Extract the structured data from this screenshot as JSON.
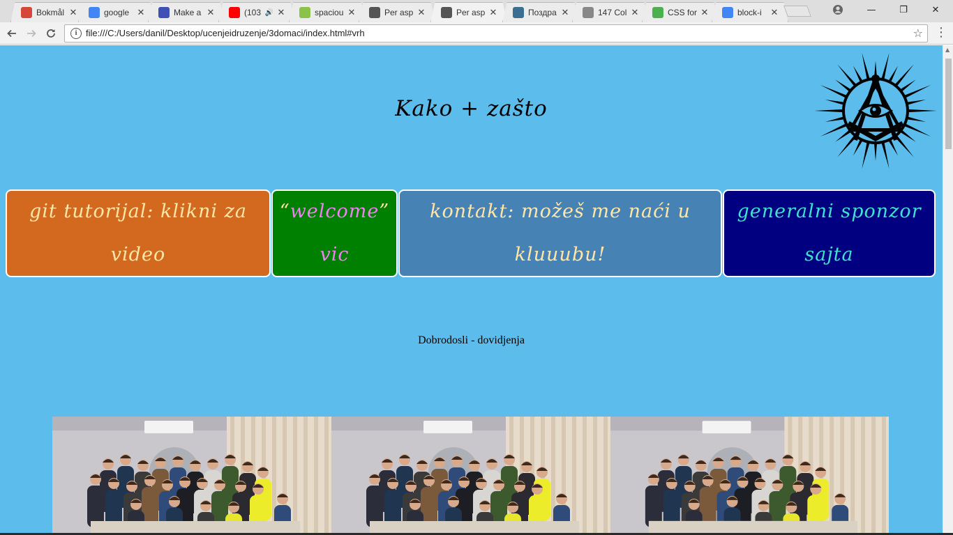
{
  "browser": {
    "tabs": [
      {
        "title": "Bokmål",
        "favicon": "gmail-icon",
        "color": "#d44638"
      },
      {
        "title": "google",
        "favicon": "google-icon",
        "color": "#4285f4"
      },
      {
        "title": "Make a",
        "favicon": "codepen-icon",
        "color": "#3f51b5"
      },
      {
        "title": "(103",
        "favicon": "youtube-icon",
        "color": "#ff0000",
        "audio": true
      },
      {
        "title": "spaciou",
        "favicon": "puzzle-icon",
        "color": "#8bc34a"
      },
      {
        "title": "Per asp",
        "favicon": "github-icon",
        "color": "#555555"
      },
      {
        "title": "Per asp",
        "favicon": "github-icon",
        "color": "#555555",
        "active": true
      },
      {
        "title": "Поздра",
        "favicon": "globe-icon",
        "color": "#3b6e8f"
      },
      {
        "title": "147 Col",
        "favicon": "file-icon",
        "color": "#888888"
      },
      {
        "title": "CSS for",
        "favicon": "w3schools-icon",
        "color": "#4caf50"
      },
      {
        "title": "block-i",
        "favicon": "google-icon",
        "color": "#4285f4"
      }
    ],
    "close_glyph": "✕",
    "address_bar": {
      "url": "file:///C:/Users/danil/Desktop/ucenjeidruzenje/3domaci/index.html#vrh"
    },
    "window_controls": {
      "minimize": "—",
      "restore": "❐",
      "close": "✕"
    }
  },
  "page": {
    "background": "#5cbdec",
    "title": "Kako + zašto",
    "logo": "masonic-eye-logo",
    "cards": [
      {
        "text": "git tutorijal: klikni za video",
        "bg": "#d2691e",
        "fg": "#ffe6a8"
      },
      {
        "text_part1": "“",
        "text_part2": "welcome",
        "text_part3": "”",
        "text_part4": "vic",
        "bg": "#008000",
        "fg": "#ee82ee",
        "quote_fg": "#ffe6a8"
      },
      {
        "text": "kontakt: možeš me naći u kluuubu!",
        "bg": "#4682b4",
        "fg": "#ffe6a8"
      },
      {
        "text": "generalni sponzor sajta",
        "bg": "#000080",
        "fg": "#40e0d0"
      }
    ],
    "welcome_text": "Dobrodosli - dovidjenja",
    "photo_count": 3
  }
}
